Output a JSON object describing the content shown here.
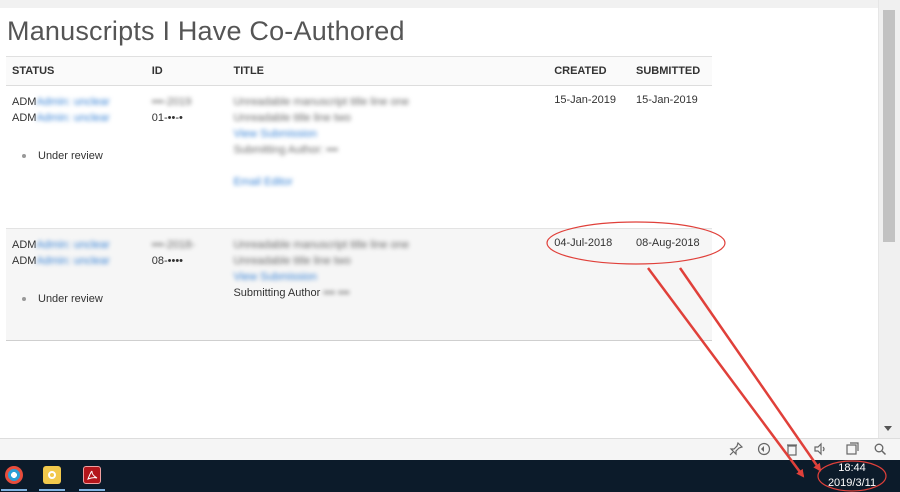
{
  "page": {
    "title": "Manuscripts I Have Co-Authored"
  },
  "table": {
    "headers": [
      "STATUS",
      "ID",
      "TITLE",
      "CREATED",
      "SUBMITTED"
    ],
    "rows": [
      {
        "status_line1": "ADM",
        "status_line1_blur": "Admin: unclear",
        "status_line2": "ADM",
        "status_line2_blur": "Admin: unclear",
        "status": "Under review",
        "id_line1": "•••-2019",
        "id_line2": "01-••-•",
        "title_lines": [
          "Unreadable manuscript title line one",
          "Unreadable title line two"
        ],
        "title_link": "View Submission",
        "title_author": "Submitting Author: •••",
        "email_link": "Email Editor",
        "created": "15-Jan-2019",
        "submitted": "15-Jan-2019"
      },
      {
        "status_line1": "ADM",
        "status_line1_blur": "Admin: unclear",
        "status_line2": "ADM",
        "status_line2_blur": "Admin: unclear",
        "status": "Under review",
        "id_line1": "•••-2018-",
        "id_line2": "08-••••",
        "title_lines": [
          "Unreadable manuscript title line one",
          "Unreadable title line two"
        ],
        "title_link": "View Submission",
        "title_author_label": "Submitting Author",
        "title_author_name": "••• •••",
        "created": "04-Jul-2018",
        "submitted": "08-Aug-2018"
      }
    ]
  },
  "taskbar": {
    "time": "18:44",
    "date": "2019/3/11"
  },
  "colors": {
    "annotation": "#e0403a",
    "link": "#3a84d6",
    "taskbar": "#0c1b2a"
  }
}
